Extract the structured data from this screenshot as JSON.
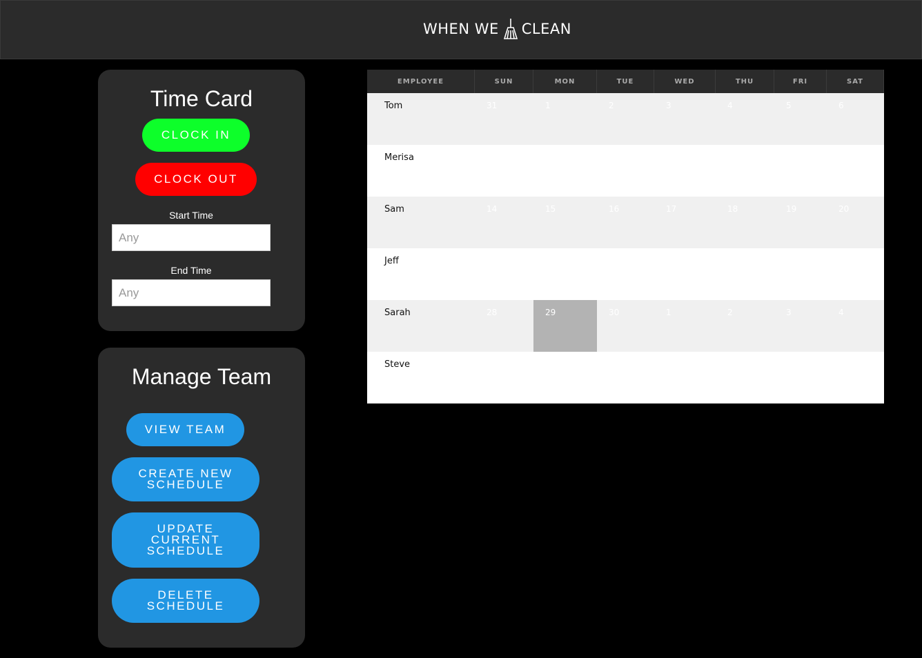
{
  "header": {
    "brand_left": "WHEN WE",
    "brand_right": "CLEAN",
    "logo_icon": "broom-icon"
  },
  "time_card": {
    "title": "Time Card",
    "clock_in": "CLOCK IN",
    "clock_out": "CLOCK OUT",
    "start_label": "Start Time",
    "start_placeholder": "Any",
    "end_label": "End Time",
    "end_placeholder": "Any",
    "colors": {
      "clock_in": "#0dff2a",
      "clock_out": "#ff0000"
    }
  },
  "manage_team": {
    "title": "Manage Team",
    "view_team": "VIEW TEAM",
    "create_line1": "CREATE NEW",
    "create_line2": "SCHEDULE",
    "update_line1": "UPDATE",
    "update_line2": "CURRENT",
    "update_line3": "SCHEDULE",
    "delete_line1": "DELETE",
    "delete_line2": "SCHEDULE",
    "color": "#2196e3"
  },
  "schedule": {
    "columns": [
      "EMPLOYEE",
      "SUN",
      "MON",
      "TUE",
      "WED",
      "THU",
      "FRI",
      "SAT"
    ],
    "rows": [
      {
        "name": "Tom",
        "days": [
          "31",
          "1",
          "2",
          "3",
          "4",
          "5",
          "6"
        ]
      },
      {
        "name": "Merisa",
        "days": [
          "",
          "",
          "",
          "",
          "",
          "",
          ""
        ]
      },
      {
        "name": "Sam",
        "days": [
          "14",
          "15",
          "16",
          "17",
          "18",
          "19",
          "20"
        ]
      },
      {
        "name": "Jeff",
        "days": [
          "",
          "",
          "",
          "",
          "",
          "",
          ""
        ]
      },
      {
        "name": "Sarah",
        "days": [
          "28",
          "29",
          "30",
          "1",
          "2",
          "3",
          "4"
        ]
      },
      {
        "name": "Steve",
        "days": [
          "",
          "",
          "",
          "",
          "",
          "",
          ""
        ]
      }
    ],
    "highlighted": {
      "row": 4,
      "day": 1
    },
    "colors": {
      "header": "#2b2b2b",
      "shade": "#f0f0f0",
      "highlight": "#b3b3b3"
    }
  }
}
